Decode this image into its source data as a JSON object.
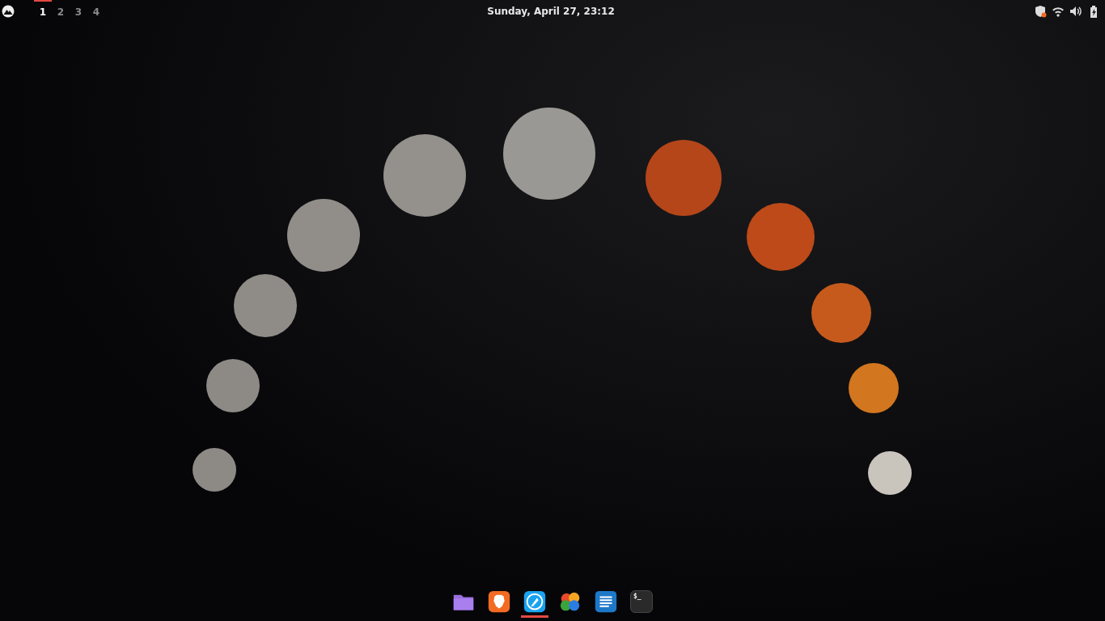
{
  "top_bar": {
    "workspaces": [
      {
        "label": "1",
        "selected": true
      },
      {
        "label": "2",
        "selected": false
      },
      {
        "label": "3",
        "selected": false
      },
      {
        "label": "4",
        "selected": false
      }
    ],
    "clock": "Sunday, April 27, 23:12"
  },
  "dock": {
    "items": [
      {
        "kind": "folder",
        "running": false
      },
      {
        "kind": "lion",
        "running": false
      },
      {
        "kind": "bird",
        "running": true
      },
      {
        "kind": "clover",
        "running": false
      },
      {
        "kind": "notes",
        "running": false
      },
      {
        "kind": "terminal",
        "running": false,
        "glyph": "$_"
      }
    ]
  }
}
